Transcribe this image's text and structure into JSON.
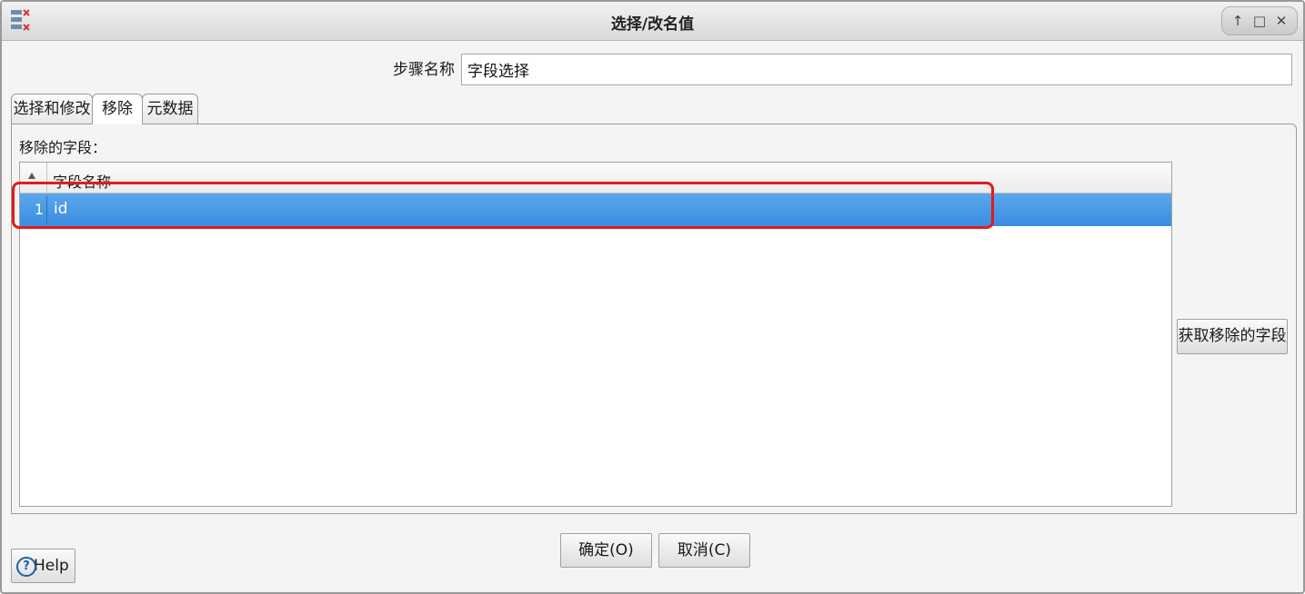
{
  "window": {
    "title": "选择/改名值"
  },
  "step": {
    "label": "步骤名称",
    "value": "字段选择"
  },
  "tabs": [
    {
      "label": "选择和修改",
      "active": false
    },
    {
      "label": "移除",
      "active": true
    },
    {
      "label": "元数据",
      "active": false
    }
  ],
  "remove_panel": {
    "section_label": "移除的字段：",
    "column_header": "字段名称",
    "rows": [
      {
        "num": "1",
        "field": "id"
      }
    ],
    "get_fields_button": "获取移除的字段"
  },
  "footer": {
    "ok_label": "确定(O)",
    "cancel_label": "取消(C)",
    "help_label": "Help"
  },
  "colors": {
    "selection": "#3b8de0",
    "highlight_box": "#e41a1a"
  }
}
